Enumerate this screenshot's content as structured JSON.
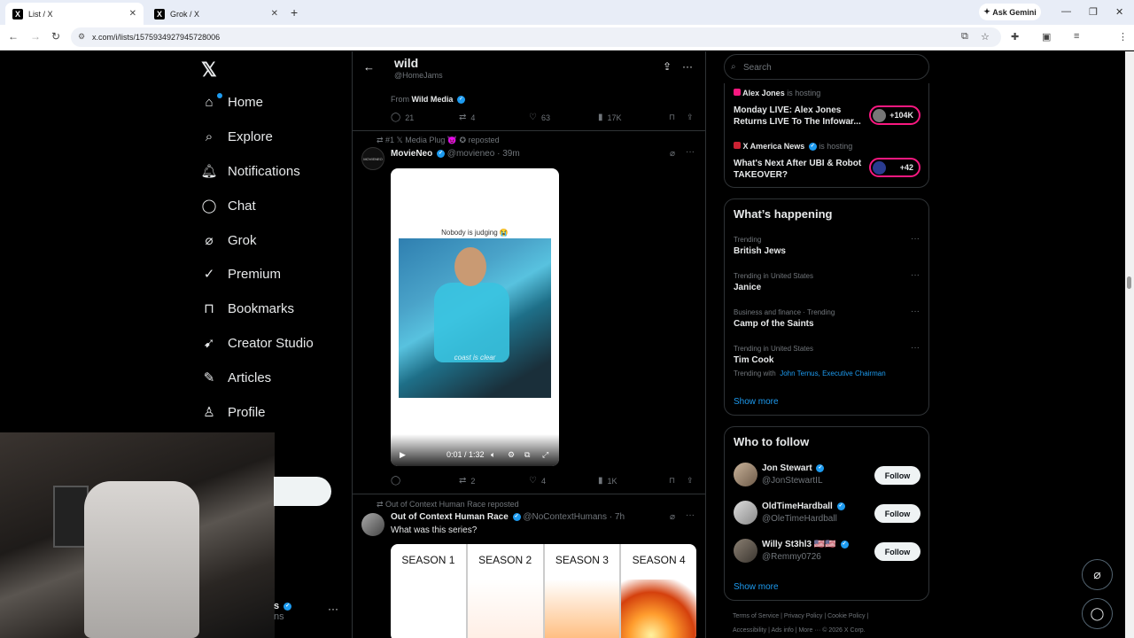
{
  "browser": {
    "tabs": [
      {
        "title": "List / X"
      },
      {
        "title": "Grok / X"
      }
    ],
    "ask_gemini": "Ask Gemini",
    "url": "x.com/i/lists/1575934927945728006"
  },
  "nav": {
    "items": [
      "Home",
      "Explore",
      "Notifications",
      "Chat",
      "Grok",
      "Premium",
      "Bookmarks",
      "Creator Studio",
      "Articles",
      "Profile"
    ],
    "account_partial_name": "s",
    "account_partial_handle": "ns"
  },
  "header": {
    "title": "wild",
    "handle": "@HomeJams"
  },
  "post1": {
    "from_label": "From",
    "from_name": "Wild Media",
    "replies": "21",
    "reposts": "4",
    "likes": "63",
    "views": "17K"
  },
  "post2": {
    "repost_label": "#1 𝕏 Media Plug 😈 ✪ reposted",
    "name": "MovieNeo",
    "handle": "@movieneo · 39m",
    "video_caption": "Nobody is judging 😭",
    "video_overlay": "coast is clear",
    "video_time": "0:01 / 1:32",
    "replies": "",
    "reposts": "2",
    "likes": "4",
    "views": "1K"
  },
  "post3": {
    "repost_label": "Out of Context Human Race reposted",
    "name": "Out of Context Human Race",
    "handle": "@NoContextHumans · 7h",
    "text": "What was this series?",
    "seasons": [
      "SEASON 1",
      "SEASON 2",
      "SEASON 3",
      "SEASON 4"
    ]
  },
  "search": {
    "placeholder": "Search"
  },
  "live": [
    {
      "host": "Alex Jones",
      "is_hosting": "is hosting",
      "title": "Monday LIVE: Alex Jones Returns LIVE To The Infowar...",
      "count": "+104K"
    },
    {
      "host": "X America News",
      "is_hosting": "is hosting",
      "title": "What's Next After UBI & Robot TAKEOVER?",
      "count": "+42"
    }
  ],
  "happening": {
    "title": "What’s happening",
    "trends": [
      {
        "context": "Trending",
        "name": "British Jews"
      },
      {
        "context": "Trending in United States",
        "name": "Janice"
      },
      {
        "context": "Business and finance · Trending",
        "name": "Camp of the Saints"
      },
      {
        "context": "Trending in United States",
        "name": "Tim Cook",
        "extra_prefix": "Trending with",
        "extra": "John Ternus, Executive Chairman"
      }
    ],
    "show_more": "Show more"
  },
  "who_to_follow": {
    "title": "Who to follow",
    "users": [
      {
        "name": "Jon Stewart",
        "handle": "@JonStewartIL"
      },
      {
        "name": "OldTimeHardball",
        "handle": "@OleTimeHardball"
      },
      {
        "name": "Willy St3hl3 🇺🇸🇺🇸",
        "handle": "@Remmy0726"
      }
    ],
    "follow_label": "Follow",
    "show_more": "Show more"
  },
  "footer": {
    "line1": "Terms of Service  |  Privacy Policy  |  Cookie Policy  |",
    "line2": "Accessibility  |  Ads info  |  More ···  © 2026 X Corp."
  }
}
